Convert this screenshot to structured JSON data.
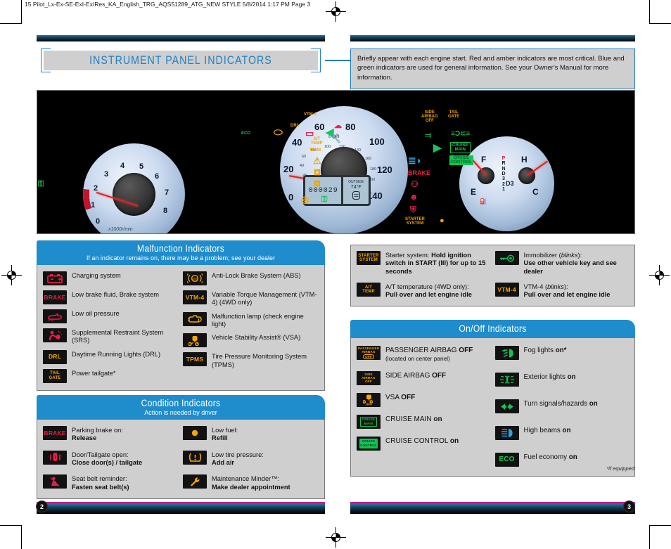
{
  "print_header": "15 Pilot_Lx-Ex-SE-ExI-ExIRes_KA_English_TRG_AQS51289_ATG_NEW STYLE  5/8/2014  1:17 PM  Page 3",
  "title": "INSTRUMENT PANEL INDICATORS",
  "intro_note": "Briefly appear with each engine start. Red and amber indicators are most critical. Blue and green indicators are used for general information. See your Owner's Manual for more information.",
  "colors": {
    "accent_blue": "#1f8ccc",
    "title_blue": "#1f7fc4",
    "panel_gray": "#cfcfcf",
    "icon_red": "#ec1c45",
    "icon_amber": "#f5a700",
    "icon_green": "#13c455",
    "icon_blue": "#2f9fe0",
    "footer_magenta": "#d5168c"
  },
  "dashboard": {
    "tachometer": {
      "labels": [
        "0",
        "1",
        "2",
        "3",
        "4",
        "5",
        "6",
        "7",
        "8"
      ],
      "unit": "x1000r/min",
      "redline_start": 6
    },
    "speedometer": {
      "mph_labels": [
        "0",
        "20",
        "40",
        "60",
        "80",
        "100",
        "120",
        "140"
      ],
      "mph_unit": "mph",
      "kmh_labels": [
        "20",
        "40",
        "60",
        "80",
        "100",
        "120",
        "140",
        "160",
        "180",
        "200",
        "220"
      ],
      "kmh_unit": "km/h"
    },
    "lcd": {
      "odometer": "000029",
      "outside_temp_label": "OUTSIDE",
      "outside_temp_value": "74°F"
    },
    "right_gauges": {
      "temp_labels": [
        "C",
        "H"
      ],
      "fuel_labels": [
        "E",
        "F"
      ],
      "gear_positions": [
        "P",
        "R",
        "N",
        "D",
        "3",
        "2",
        "1"
      ],
      "gear_display": "D3"
    },
    "telltale_labels": [
      "VTM-4",
      "DRL",
      "ECO",
      "A/T TEMP",
      "TPMS",
      "SIDE AIRBAG OFF",
      "TAIL GATE",
      "BRAKE",
      "STARTER SYSTEM",
      "CRUISE MAIN",
      "CRUISE CONTROL"
    ]
  },
  "malfunction": {
    "title": "Malfunction Indicators",
    "subtitle": "If an indicator remains on, there may be a problem; see your dealer",
    "left_items": [
      {
        "icon": "battery-icon",
        "icon_text": "",
        "color": "#ec1c45",
        "label": "Charging system"
      },
      {
        "icon": "brake-word-icon",
        "icon_text": "BRAKE",
        "color": "#ec1c45",
        "label": "Low brake fluid, Brake system"
      },
      {
        "icon": "oil-can-icon",
        "icon_text": "",
        "color": "#ec1c45",
        "label": "Low oil pressure"
      },
      {
        "icon": "srs-airbag-icon",
        "icon_text": "",
        "color": "#ec1c45",
        "label": "Supplemental Restraint System (SRS)"
      },
      {
        "icon": "drl-word-icon",
        "icon_text": "DRL",
        "color": "#f5a700",
        "label": "Daytime Running Lights (DRL)"
      },
      {
        "icon": "tailgate-word-icon",
        "icon_text": "TAIL GATE",
        "color": "#f5a700",
        "label": "Power tailgate*"
      }
    ],
    "right_items": [
      {
        "icon": "abs-icon",
        "icon_text": "ABS",
        "color": "#f5a700",
        "label": "Anti-Lock Brake System (ABS)"
      },
      {
        "icon": "vtm4-word-icon",
        "icon_text": "VTM-4",
        "color": "#f5a700",
        "label": "Variable Torque Management (VTM-4) (4WD only)"
      },
      {
        "icon": "check-engine-icon",
        "icon_text": "",
        "color": "#f5a700",
        "label": "Malfunction lamp (check engine light)"
      },
      {
        "icon": "vsa-icon",
        "icon_text": "",
        "color": "#f5a700",
        "label": "Vehicle Stability Assist® (VSA)"
      },
      {
        "icon": "tpms-word-icon",
        "icon_text": "TPMS",
        "color": "#f5a700",
        "label": "Tire Pressure Monitoring System (TPMS)"
      }
    ]
  },
  "condition": {
    "title": "Condition Indicators",
    "subtitle": "Action is needed by driver",
    "left_items": [
      {
        "icon": "brake-word-icon",
        "icon_text": "BRAKE",
        "color": "#ec1c45",
        "label": "Parking brake on:",
        "action": "Release"
      },
      {
        "icon": "door-open-icon",
        "icon_text": "",
        "color": "#ec1c45",
        "label": "Door/Tailgate open:",
        "action": "Close door(s) / tailgate"
      },
      {
        "icon": "seatbelt-icon",
        "icon_text": "",
        "color": "#ec1c45",
        "label": "Seat belt reminder:",
        "action": "Fasten seat belt(s)"
      }
    ],
    "right_items": [
      {
        "icon": "fuel-pump-icon",
        "icon_text": "",
        "color": "#f5a700",
        "label": "Low fuel:",
        "action": "Refill"
      },
      {
        "icon": "tire-pressure-icon",
        "icon_text": "",
        "color": "#f5a700",
        "label": "Low tire pressure:",
        "action": "Add air"
      },
      {
        "icon": "wrench-icon",
        "icon_text": "",
        "color": "#f5a700",
        "label": "Maintenance Minder™:",
        "action": "Make dealer appointment"
      }
    ]
  },
  "action_box": {
    "left_items": [
      {
        "icon": "starter-system-word-icon",
        "icon_text": "STARTER SYSTEM",
        "color": "#f5a700",
        "label": "Starter system:",
        "action": "Hold ignition switch in START (III) for up to 15 seconds"
      },
      {
        "icon": "at-temp-word-icon",
        "icon_text": "A/T TEMP",
        "color": "#f5a700",
        "label": "A/T temperature (4WD only):",
        "action": "Pull over and let engine idle"
      }
    ],
    "right_items": [
      {
        "icon": "immobilizer-key-icon",
        "icon_text": "",
        "color": "#13c455",
        "label": "Immobilizer (blinks):",
        "action": "Use other vehicle key and see dealer"
      },
      {
        "icon": "vtm4-word-icon",
        "icon_text": "VTM-4",
        "color": "#f5a700",
        "label": "VTM-4 (blinks):",
        "action": "Pull over and let engine idle"
      }
    ]
  },
  "onoff": {
    "title": "On/Off Indicators",
    "left_items": [
      {
        "icon": "passenger-airbag-off-icon",
        "icon_text": "PASSENGER AIRBAG",
        "icon_text2": "OFF",
        "color": "#f5a700",
        "label": "PASSENGER AIRBAG ",
        "bold": "OFF",
        "sub": "(located on center panel)"
      },
      {
        "icon": "side-airbag-off-icon",
        "icon_text": "SIDE AIRBAG OFF",
        "color": "#f5a700",
        "label": "SIDE AIRBAG ",
        "bold": "OFF",
        "sub": ""
      },
      {
        "icon": "vsa-off-icon",
        "icon_text": "OFF",
        "color": "#f5a700",
        "label": "VSA ",
        "bold": "OFF",
        "sub": ""
      },
      {
        "icon": "cruise-main-icon",
        "icon_text": "CRUISE MAIN",
        "color": "#13c455",
        "label": "CRUISE MAIN ",
        "bold": "on",
        "sub": ""
      },
      {
        "icon": "cruise-control-icon",
        "icon_text": "CRUISE CONTROL",
        "color": "#13c455",
        "label": "CRUISE CONTROL ",
        "bold": "on",
        "sub": ""
      }
    ],
    "right_items": [
      {
        "icon": "fog-light-icon",
        "icon_text": "",
        "color": "#13c455",
        "label": "Fog lights ",
        "bold": "on*",
        "sub": ""
      },
      {
        "icon": "exterior-lights-icon",
        "icon_text": "",
        "color": "#13c455",
        "label": "Exterior lights ",
        "bold": "on",
        "sub": ""
      },
      {
        "icon": "turn-signal-icon",
        "icon_text": "",
        "color": "#13c455",
        "label": "Turn signals/hazards ",
        "bold": "on",
        "sub": ""
      },
      {
        "icon": "high-beam-icon",
        "icon_text": "",
        "color": "#2f9fe0",
        "label": "High beams ",
        "bold": "on",
        "sub": ""
      },
      {
        "icon": "eco-word-icon",
        "icon_text": "ECO",
        "color": "#13c455",
        "label": "Fuel economy ",
        "bold": "on",
        "sub": ""
      }
    ]
  },
  "footnote": "*if equipped",
  "page_numbers": {
    "left": "2",
    "right": "3"
  }
}
